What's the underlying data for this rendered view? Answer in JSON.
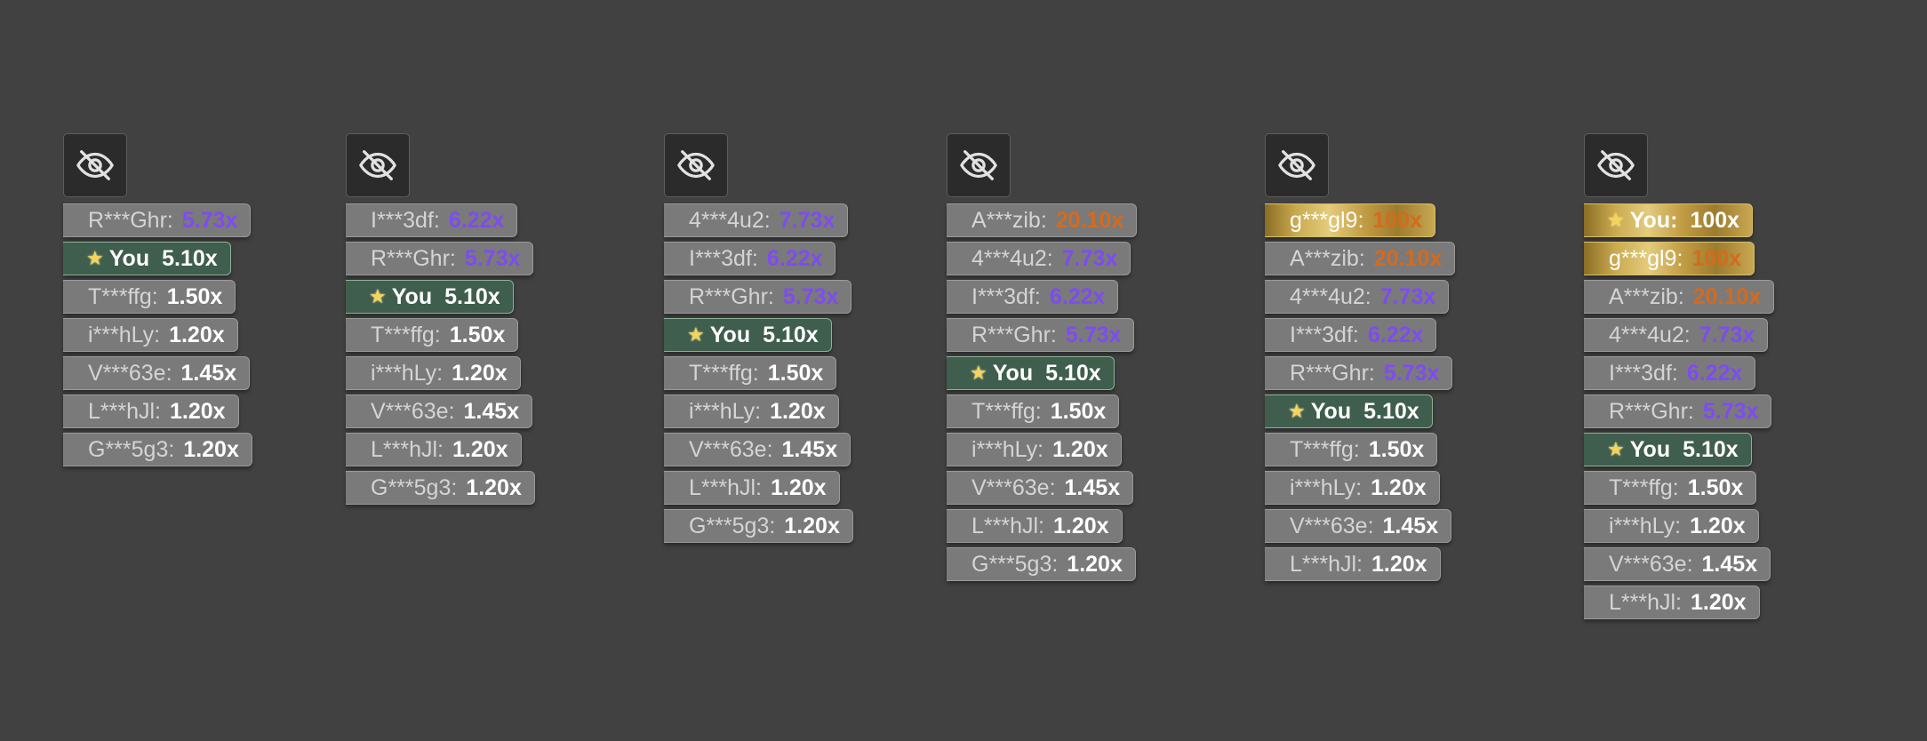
{
  "icons": {
    "toggle_visibility": "eye-slash-icon",
    "you_marker": "star-icon"
  },
  "colors": {
    "background": "#414141",
    "row_default": "#7a7a7a",
    "row_you": "#3f5e4d",
    "row_gold": "#c9a94e",
    "mult_purple": "#7d4cf2",
    "mult_orange": "#d66a1c",
    "star": "#f6d35a"
  },
  "boards": [
    {
      "rows": [
        {
          "name": "R***Ghr:",
          "mult": "5.73x",
          "tier": "purple"
        },
        {
          "name": "You",
          "mult": "5.10x",
          "you": true
        },
        {
          "name": "T***ffg:",
          "mult": "1.50x"
        },
        {
          "name": "i***hLy:",
          "mult": "1.20x"
        },
        {
          "name": "V***63e:",
          "mult": "1.45x"
        },
        {
          "name": "L***hJl:",
          "mult": "1.20x"
        },
        {
          "name": "G***5g3:",
          "mult": "1.20x"
        }
      ]
    },
    {
      "rows": [
        {
          "name": "I***3df:",
          "mult": "6.22x",
          "tier": "purple"
        },
        {
          "name": "R***Ghr:",
          "mult": "5.73x",
          "tier": "purple"
        },
        {
          "name": "You",
          "mult": "5.10x",
          "you": true
        },
        {
          "name": "T***ffg:",
          "mult": "1.50x"
        },
        {
          "name": "i***hLy:",
          "mult": "1.20x"
        },
        {
          "name": "V***63e:",
          "mult": "1.45x"
        },
        {
          "name": "L***hJl:",
          "mult": "1.20x"
        },
        {
          "name": "G***5g3:",
          "mult": "1.20x"
        }
      ]
    },
    {
      "rows": [
        {
          "name": "4***4u2:",
          "mult": "7.73x",
          "tier": "purple"
        },
        {
          "name": "I***3df:",
          "mult": "6.22x",
          "tier": "purple"
        },
        {
          "name": "R***Ghr:",
          "mult": "5.73x",
          "tier": "purple"
        },
        {
          "name": "You",
          "mult": "5.10x",
          "you": true
        },
        {
          "name": "T***ffg:",
          "mult": "1.50x"
        },
        {
          "name": "i***hLy:",
          "mult": "1.20x"
        },
        {
          "name": "V***63e:",
          "mult": "1.45x"
        },
        {
          "name": "L***hJl:",
          "mult": "1.20x"
        },
        {
          "name": "G***5g3:",
          "mult": "1.20x"
        }
      ]
    },
    {
      "rows": [
        {
          "name": "A***zib:",
          "mult": "20.10x",
          "tier": "orange"
        },
        {
          "name": "4***4u2:",
          "mult": "7.73x",
          "tier": "purple"
        },
        {
          "name": "I***3df:",
          "mult": "6.22x",
          "tier": "purple"
        },
        {
          "name": "R***Ghr:",
          "mult": "5.73x",
          "tier": "purple"
        },
        {
          "name": "You",
          "mult": "5.10x",
          "you": true
        },
        {
          "name": "T***ffg:",
          "mult": "1.50x"
        },
        {
          "name": "i***hLy:",
          "mult": "1.20x"
        },
        {
          "name": "V***63e:",
          "mult": "1.45x"
        },
        {
          "name": "L***hJl:",
          "mult": "1.20x"
        },
        {
          "name": "G***5g3:",
          "mult": "1.20x"
        }
      ]
    },
    {
      "rows": [
        {
          "name": "g***gl9:",
          "mult": "100x",
          "tier": "orange",
          "gold": true
        },
        {
          "name": "A***zib:",
          "mult": "20.10x",
          "tier": "orange"
        },
        {
          "name": "4***4u2:",
          "mult": "7.73x",
          "tier": "purple"
        },
        {
          "name": "I***3df:",
          "mult": "6.22x",
          "tier": "purple"
        },
        {
          "name": "R***Ghr:",
          "mult": "5.73x",
          "tier": "purple"
        },
        {
          "name": "You",
          "mult": "5.10x",
          "you": true
        },
        {
          "name": "T***ffg:",
          "mult": "1.50x"
        },
        {
          "name": "i***hLy:",
          "mult": "1.20x"
        },
        {
          "name": "V***63e:",
          "mult": "1.45x"
        },
        {
          "name": "L***hJl:",
          "mult": "1.20x"
        }
      ]
    },
    {
      "rows": [
        {
          "name": "You:",
          "mult": "100x",
          "you": true,
          "gold": true
        },
        {
          "name": "g***gl9:",
          "mult": "100x",
          "tier": "orange",
          "gold": true
        },
        {
          "name": "A***zib:",
          "mult": "20.10x",
          "tier": "orange"
        },
        {
          "name": "4***4u2:",
          "mult": "7.73x",
          "tier": "purple"
        },
        {
          "name": "I***3df:",
          "mult": "6.22x",
          "tier": "purple"
        },
        {
          "name": "R***Ghr:",
          "mult": "5.73x",
          "tier": "purple"
        },
        {
          "name": "You",
          "mult": "5.10x",
          "you": true
        },
        {
          "name": "T***ffg:",
          "mult": "1.50x"
        },
        {
          "name": "i***hLy:",
          "mult": "1.20x"
        },
        {
          "name": "V***63e:",
          "mult": "1.45x"
        },
        {
          "name": "L***hJl:",
          "mult": "1.20x"
        }
      ]
    }
  ]
}
